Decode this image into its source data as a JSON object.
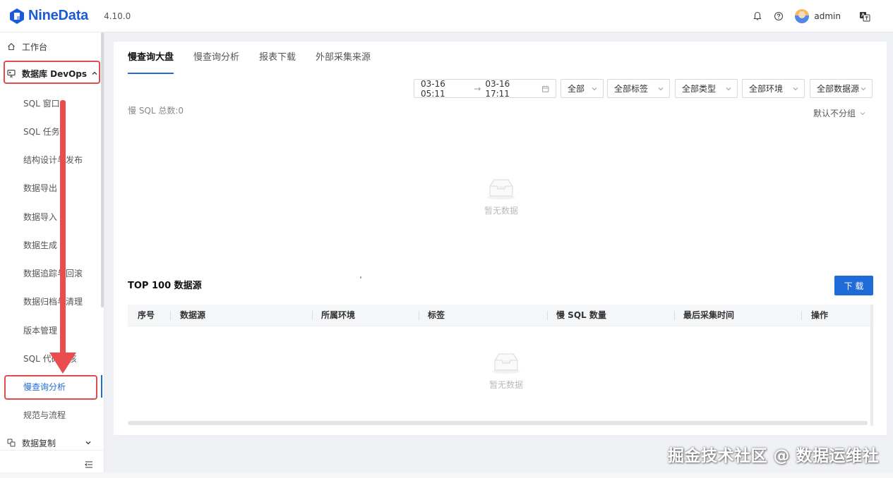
{
  "app": {
    "name": "NineData",
    "version": "4.10.0"
  },
  "header": {
    "username": "admin"
  },
  "sidebar": {
    "workbench": "工作台",
    "group": "数据库 DevOps",
    "items": [
      "SQL 窗口",
      "SQL 任务",
      "结构设计与发布",
      "数据导出",
      "数据导入",
      "数据生成",
      "数据追踪与回滚",
      "数据归档与清理",
      "版本管理",
      "SQL 代码审核",
      "慢查询分析",
      "规范与流程"
    ],
    "next_group": "数据复制"
  },
  "tabs": [
    "慢查询大盘",
    "慢查询分析",
    "报表下载",
    "外部采集来源"
  ],
  "filters": {
    "start": "03-16 05:11",
    "end": "03-16 17:11",
    "all": "全部",
    "tags": "全部标签",
    "types": "全部类型",
    "envs": "全部环境",
    "sources": "全部数据源"
  },
  "summary": {
    "total_label": "慢 SQL 总数:0",
    "grouping": "默认不分组"
  },
  "empty_text": "暂无数据",
  "top_section": {
    "title": "TOP 100 数据源",
    "download": "下 载",
    "columns": [
      "序号",
      "数据源",
      "所属环境",
      "标签",
      "慢 SQL 数量",
      "最后采集时间",
      "操作"
    ]
  },
  "watermark": "掘金技术社区 @ 数据运维社",
  "colors": {
    "accent": "#1f6bd8",
    "annotation": "#e24b4b"
  }
}
